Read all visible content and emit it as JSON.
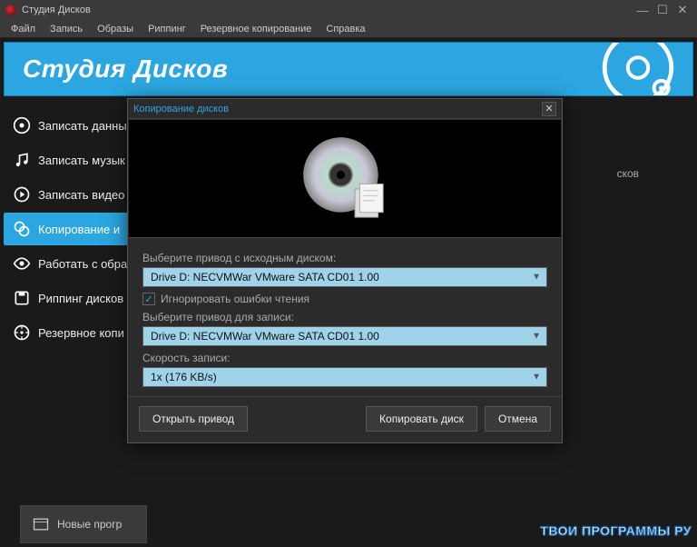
{
  "window": {
    "title": "Студия Дисков"
  },
  "menubar": [
    "Файл",
    "Запись",
    "Образы",
    "Риппинг",
    "Резервное копирование",
    "Справка"
  ],
  "banner": {
    "title": "Студия Дисков"
  },
  "sidebar": {
    "items": [
      {
        "label": "Записать данны"
      },
      {
        "label": "Записать музык"
      },
      {
        "label": "Записать видео"
      },
      {
        "label": "Копирование и"
      },
      {
        "label": "Работать с обра"
      },
      {
        "label": "Риппинг дисков"
      },
      {
        "label": "Резервное копи"
      }
    ],
    "active_index": 3
  },
  "footer_button": "Новые прогр",
  "truncated_text": "сков",
  "dialog": {
    "title": "Копирование дисков",
    "source_label": "Выберите привод с исходным диском:",
    "source_value": "Drive D: NECVMWar VMware SATA CD01 1.00",
    "ignore_errors_label": "Игнорировать ошибки чтения",
    "ignore_errors_checked": true,
    "dest_label": "Выберите привод для записи:",
    "dest_value": "Drive D: NECVMWar VMware SATA CD01 1.00",
    "speed_label": "Скорость записи:",
    "speed_value": "1x (176 KB/s)",
    "buttons": {
      "open_drive": "Открыть привод",
      "copy_disc": "Копировать диск",
      "cancel": "Отмена"
    }
  },
  "watermark": "ТВОИ ПРОГРАММЫ РУ"
}
